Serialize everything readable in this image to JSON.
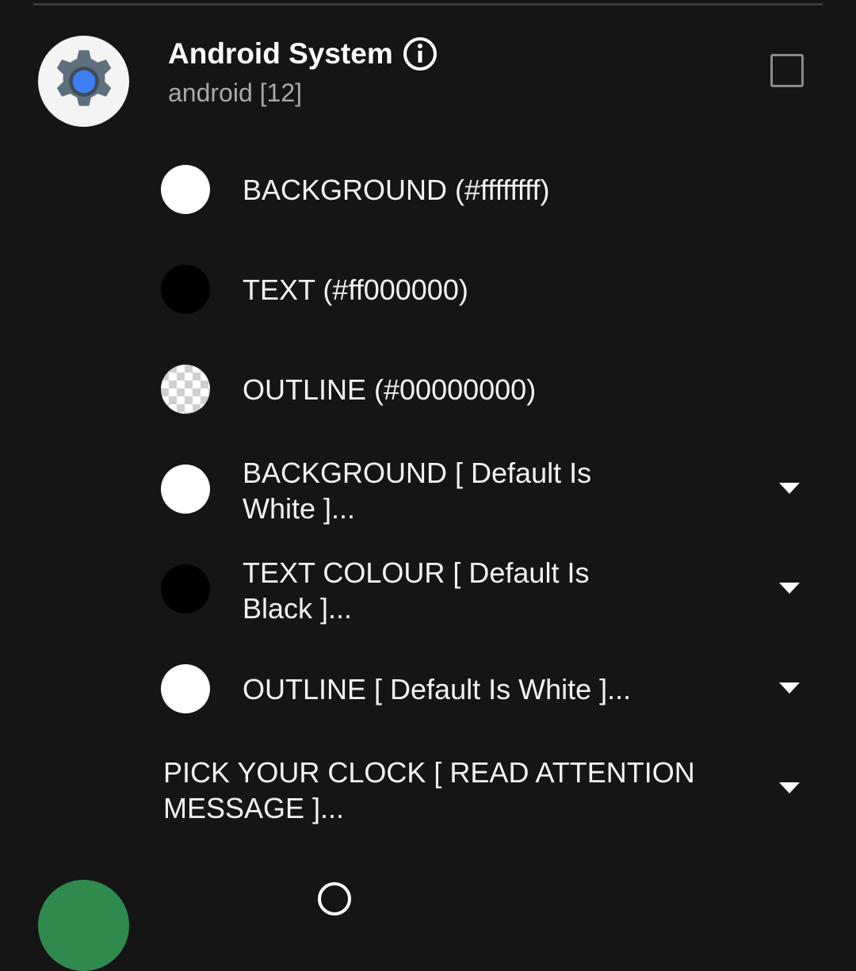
{
  "app": {
    "name": "Android System",
    "package": "android [12]"
  },
  "color_rows": [
    {
      "label": "BACKGROUND (#ffffffff)",
      "swatch": "#ffffff"
    },
    {
      "label": "TEXT (#ff000000)",
      "swatch": "#000000"
    },
    {
      "label": "OUTLINE (#00000000)",
      "swatch": "transparent"
    }
  ],
  "dropdown_rows": [
    {
      "label": "BACKGROUND [ Default Is White ]...",
      "swatch": "#ffffff"
    },
    {
      "label": "TEXT COLOUR [ Default Is Black ]...",
      "swatch": "#000000"
    },
    {
      "label": "OUTLINE [ Default Is White ]...",
      "swatch": "#ffffff"
    }
  ],
  "clock_row": {
    "label": "PICK YOUR CLOCK [ READ ATTENTION MESSAGE ]..."
  },
  "next_app": {
    "name": "",
    "avatar_color": "#2f8a4e"
  },
  "icons": [
    "settings-gear-icon",
    "info-icon",
    "checkbox-icon",
    "dropdown-arrow-icon"
  ]
}
